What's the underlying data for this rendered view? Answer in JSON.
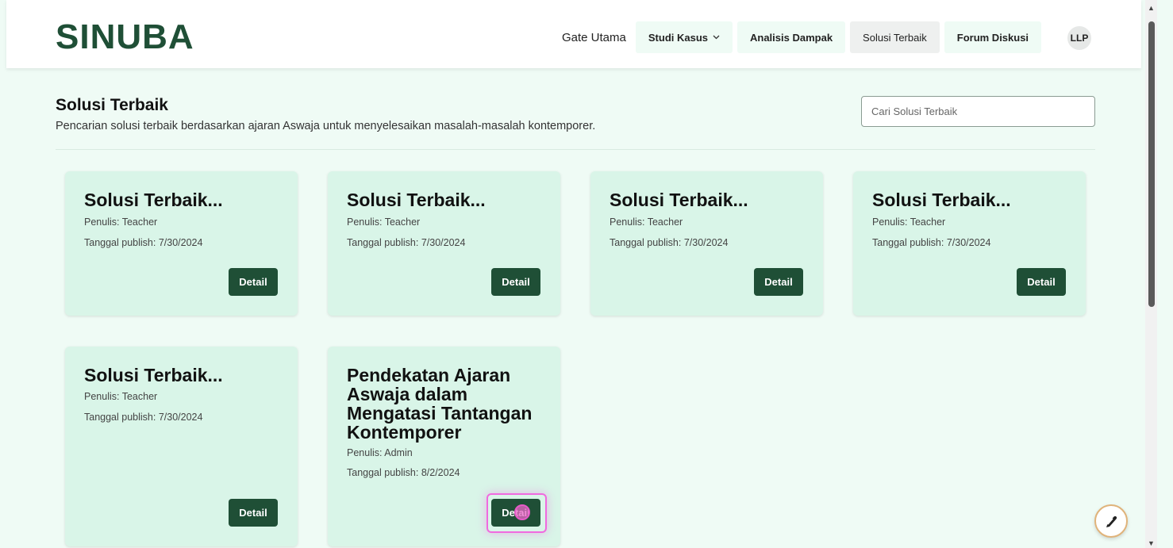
{
  "header": {
    "logo": "SINUBA",
    "nav": {
      "gate_utama": "Gate Utama",
      "studi_kasus": "Studi Kasus",
      "analisis_dampak": "Analisis Dampak",
      "solusi_terbaik": "Solusi Terbaik",
      "forum_diskusi": "Forum Diskusi"
    },
    "user_initials": "LLP"
  },
  "page": {
    "title": "Solusi Terbaik",
    "subtitle": "Pencarian solusi terbaik berdasarkan ajaran Aswaja untuk menyelesaikan masalah-masalah kontemporer.",
    "search_placeholder": "Cari Solusi Terbaik"
  },
  "cards": [
    {
      "title": "Solusi Terbaik...",
      "author": "Penulis: Teacher",
      "date": "Tanggal publish: 7/30/2024",
      "button": "Detail"
    },
    {
      "title": "Solusi Terbaik...",
      "author": "Penulis: Teacher",
      "date": "Tanggal publish: 7/30/2024",
      "button": "Detail"
    },
    {
      "title": "Solusi Terbaik...",
      "author": "Penulis: Teacher",
      "date": "Tanggal publish: 7/30/2024",
      "button": "Detail"
    },
    {
      "title": "Solusi Terbaik...",
      "author": "Penulis: Teacher",
      "date": "Tanggal publish: 7/30/2024",
      "button": "Detail"
    },
    {
      "title": "Solusi Terbaik...",
      "author": "Penulis: Teacher",
      "date": "Tanggal publish: 7/30/2024",
      "button": "Detail"
    },
    {
      "title": "Pendekatan Ajaran Aswaja dalam Mengatasi Tantangan Kontemporer",
      "author": "Penulis: Admin",
      "date": "Tanggal publish: 8/2/2024",
      "button": "Detail"
    }
  ],
  "colors": {
    "brand": "#1f4f36",
    "card_bg": "#d9f5e8",
    "page_bg": "#effbf5",
    "focus_ring": "#f06adf"
  },
  "icons": {
    "dropdown": "chevron-down-icon",
    "floating_action": "pen-icon"
  }
}
